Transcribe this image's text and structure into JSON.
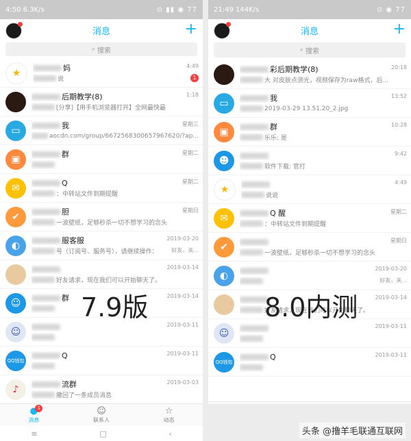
{
  "left": {
    "status": {
      "time": "4:50",
      "speed": "6.3K/s",
      "icons": "⊙ ▮▮ ◉ 77"
    },
    "title": "消息",
    "search_placeholder": "搜索",
    "rows": [
      {
        "color": "#ffffff",
        "glyph": "★",
        "glyphColor": "#f6b800",
        "name": "妈",
        "msg": "说",
        "time": "4:49",
        "badge": "1",
        "badgeGray": false
      },
      {
        "color": "#2b1a12",
        "glyph": "",
        "glyphColor": "#fff",
        "name": "后期教学(8)",
        "msg": "[分享]【用手机浏览器打开】全网最快最",
        "time": "1:18",
        "badge": "",
        "badgeGray": true
      },
      {
        "color": "#29a9e1",
        "glyph": "▭",
        "glyphColor": "#fff",
        "name": "我",
        "msg": "aocdn.com/group/6672568300657967620/?ap...",
        "time": "星期三",
        "badge": "",
        "badgeGray": false
      },
      {
        "color": "#ff8a3d",
        "glyph": "▣",
        "glyphColor": "#fff",
        "name": "群",
        "msg": "",
        "time": "星期二",
        "badge": "",
        "badgeGray": false
      },
      {
        "color": "#ffc107",
        "glyph": "✉",
        "glyphColor": "#fff",
        "name": "Q",
        "msg": "：中转站文件到期提醒",
        "time": "星期二",
        "badge": "",
        "badgeGray": false
      },
      {
        "color": "#ff9a3c",
        "glyph": "✔",
        "glyphColor": "#fff",
        "name": "胆",
        "msg": "一波壁纸，足够秒杀一切不想学习的念头",
        "time": "星期日",
        "badge": "",
        "badgeGray": false
      },
      {
        "color": "#4aa3e8",
        "glyph": "◐",
        "glyphColor": "#fff",
        "name": "服客服",
        "msg": "号（订阅号、服务号），请继续操作：",
        "time": "2019-03-20",
        "badge": "好友，关...",
        "badgeGray": true
      },
      {
        "color": "#e8c9a0",
        "glyph": "",
        "glyphColor": "#fff",
        "name": "",
        "msg": "好友请求，现在我们可以开始聊天了。",
        "time": "2019-03-14",
        "badge": "",
        "badgeGray": false
      },
      {
        "color": "#1d98e6",
        "glyph": "☺",
        "glyphColor": "#fff",
        "name": "群",
        "msg": "",
        "time": "2019-03-14",
        "badge": "",
        "badgeGray": false
      },
      {
        "color": "#dfe7f5",
        "glyph": "☺",
        "glyphColor": "#3b5bb3",
        "name": "",
        "msg": "",
        "time": "2019-03-11",
        "badge": "",
        "badgeGray": false
      },
      {
        "color": "#1d98e6",
        "glyph": "QQ钱包",
        "glyphColor": "#fff",
        "name": "Q",
        "msg": "",
        "time": "2019-03-11",
        "badge": "",
        "badgeGray": false
      },
      {
        "color": "#f5f0e6",
        "glyph": "♪",
        "glyphColor": "#d24",
        "name": "流群",
        "msg": "撤回了一条成员消息",
        "time": "2019-03-03",
        "badge": "",
        "badgeGray": false
      }
    ],
    "overlay": "7.9版",
    "tabs": [
      {
        "label": "消息",
        "icon": "●",
        "badge": "1"
      },
      {
        "label": "联系人",
        "icon": "☺",
        "badge": ""
      },
      {
        "label": "动态",
        "icon": "☆",
        "badge": ""
      }
    ],
    "nav": [
      "≡",
      "□",
      "‹"
    ]
  },
  "right": {
    "status": {
      "time": "21:49",
      "speed": "144K/s",
      "icons": "⊙ ◉ 77"
    },
    "title": "消息",
    "search_placeholder": "搜索",
    "rows": [
      {
        "color": "#2b1a12",
        "glyph": "",
        "glyphColor": "#fff",
        "name": "彩后期教学(8)",
        "msg": "大 对皮肤点测光，视频保存为raw格式，后...",
        "time": "20:18",
        "badge": "",
        "badgeGray": true
      },
      {
        "color": "#29a9e1",
        "glyph": "▭",
        "glyphColor": "#fff",
        "name": "我",
        "msg": "2019-03-29 13.51.20_2.jpg",
        "time": "13:52",
        "badge": "",
        "badgeGray": false
      },
      {
        "color": "#ff8a3d",
        "glyph": "▣",
        "glyphColor": "#fff",
        "name": "群",
        "msg": "乐乐: 是",
        "time": "10:28",
        "badge": "",
        "badgeGray": true
      },
      {
        "color": "#1d98e6",
        "glyph": "☻",
        "glyphColor": "#fff",
        "name": "",
        "msg": "软件下载: 官打",
        "time": "9:42",
        "badge": "",
        "badgeGray": false
      },
      {
        "color": "#ffffff",
        "glyph": "★",
        "glyphColor": "#f6b800",
        "name": "",
        "msg": "说说",
        "time": "4:49",
        "badge": "",
        "badgeGray": false
      },
      {
        "color": "#ffc107",
        "glyph": "✉",
        "glyphColor": "#fff",
        "name": "Q 醒",
        "msg": "：中转站文件到期提醒",
        "time": "星期二",
        "badge": "",
        "badgeGray": false
      },
      {
        "color": "#ff9a3c",
        "glyph": "✔",
        "glyphColor": "#fff",
        "name": "",
        "msg": "一波壁纸，足够秒杀一切不想学习的念头",
        "time": "星期日",
        "badge": "",
        "badgeGray": false
      },
      {
        "color": "#4aa3e8",
        "glyph": "◐",
        "glyphColor": "#fff",
        "name": "",
        "msg": "",
        "time": "2019-03-20",
        "badge": "好友，关...",
        "badgeGray": true
      },
      {
        "color": "#e8c9a0",
        "glyph": "",
        "glyphColor": "#fff",
        "name": "",
        "msg": "好友请求，现在我们可以开始聊天了。",
        "time": "2019-03-14",
        "badge": "",
        "badgeGray": false
      },
      {
        "color": "#dfe7f5",
        "glyph": "☺",
        "glyphColor": "#3b5bb3",
        "name": "",
        "msg": "",
        "time": "2019-03-11",
        "badge": "",
        "badgeGray": false
      },
      {
        "color": "#1d98e6",
        "glyph": "QQ钱包",
        "glyphColor": "#fff",
        "name": "Q",
        "msg": "",
        "time": "2019-03-11",
        "badge": "",
        "badgeGray": false
      }
    ],
    "overlay": "8.0内测",
    "tabs": [
      {
        "label": "消息",
        "icon": "●",
        "badge": ""
      },
      {
        "label": "联系人",
        "icon": "☺",
        "badge": ""
      },
      {
        "label": "动态",
        "icon": "☆",
        "badge": ""
      }
    ]
  },
  "watermark": "头条 @撸羊毛联通互联网"
}
